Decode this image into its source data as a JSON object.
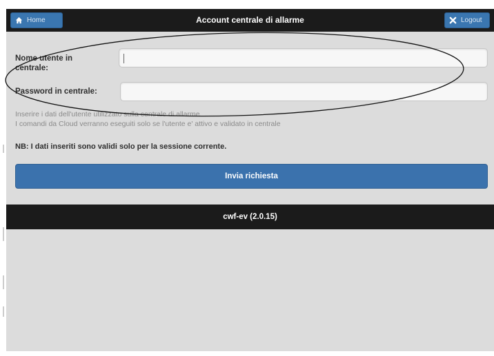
{
  "header": {
    "title": "Account centrale di allarme",
    "home_label": "Home",
    "logout_label": "Logout"
  },
  "form": {
    "username_label": "Nome utente in centrale:",
    "username_value": "",
    "password_label": "Password in centrale:",
    "password_value": ""
  },
  "info": {
    "line1": "Inserire i dati dell'utente utilizzato sulla centrale di allarme",
    "line2": "I comandi da Cloud verranno eseguiti solo se l'utente e' attivo e validato in centrale"
  },
  "note": "NB: I dati inseriti sono validi solo per la sessione corrente.",
  "submit_label": "Invia richiesta",
  "footer": "cwf-ev (2.0.15)",
  "colors": {
    "header_bg": "#1b1b1b",
    "accent": "#3b72ad",
    "page_bg": "#dcdcdc"
  },
  "icons": {
    "home": "home-icon",
    "logout": "close-icon"
  }
}
